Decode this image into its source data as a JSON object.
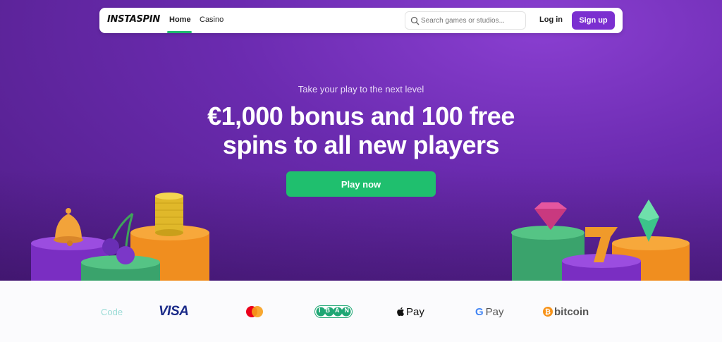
{
  "brand": {
    "logo_text": "INSTASPIN"
  },
  "nav": {
    "home_label": "Home",
    "casino_label": "Casino",
    "search_placeholder": "Search games or studios...",
    "login_label": "Log in",
    "signup_label": "Sign up"
  },
  "hero": {
    "subtitle": "Take your play to the next level",
    "headline": "€1,000 bonus and 100 free spins to all new players",
    "cta_label": "Play now"
  },
  "payments": {
    "code_label": "Code",
    "visa_label": "VISA",
    "iban_label": "IBAN",
    "apple_pay_label": "Pay",
    "google_pay_label": "Pay",
    "bitcoin_label": "bitcoin"
  },
  "colors": {
    "brand_purple": "#7b2fd0",
    "cta_green": "#1fbf6e",
    "hero_bg": "#6b2bb0"
  },
  "icons": [
    "search-icon",
    "bell-icon",
    "cherries-icon",
    "coin-stack-icon",
    "diamond-icon",
    "seven-icon",
    "gem-icon",
    "mastercard-icon",
    "apple-icon",
    "google-g-icon",
    "bitcoin-icon"
  ]
}
